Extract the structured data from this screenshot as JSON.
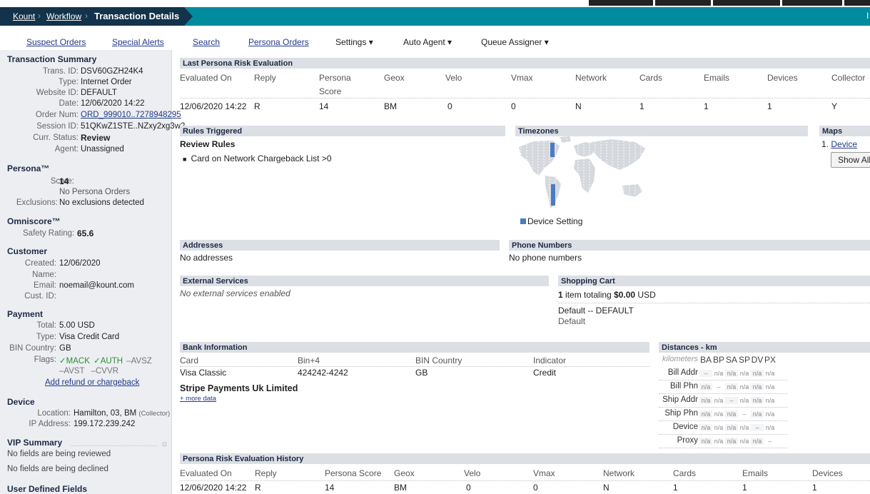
{
  "breadcrumb": {
    "items": [
      "Kount",
      "Workflow"
    ],
    "current": "Transaction Details",
    "right": "l"
  },
  "nav": {
    "suspect": "Suspect Orders",
    "alerts": "Special Alerts",
    "search": "Search",
    "persona": "Persona Orders",
    "settings": "Settings ▾",
    "auto": "Auto Agent ▾",
    "queue": "Queue Assigner ▾"
  },
  "summary": {
    "title": "Transaction Summary",
    "rows": [
      [
        "Trans. ID:",
        "DSV60GZH24K4"
      ],
      [
        "Type:",
        "Internet Order"
      ],
      [
        "Website ID:",
        "DEFAULT"
      ],
      [
        "Date:",
        "12/06/2020 14:22"
      ],
      [
        "Order Num:",
        "ORD_999010..7278948295"
      ],
      [
        "Session ID:",
        "51QKwZ1STE..NZxy2xg3w2"
      ],
      [
        "Curr. Status:",
        "Review"
      ],
      [
        "Agent:",
        "Unassigned"
      ]
    ]
  },
  "persona": {
    "title": "Persona™",
    "score_label": "Score:",
    "score": "14",
    "orders": "No Persona Orders",
    "excl_label": "Exclusions:",
    "excl": "No exclusions detected"
  },
  "omni": {
    "title": "Omniscore™",
    "label": "Safety Rating:",
    "value": "65.6"
  },
  "customer": {
    "title": "Customer",
    "rows": [
      [
        "Created:",
        "12/06/2020"
      ],
      [
        "Name:",
        ""
      ],
      [
        "Email:",
        "noemail@kount.com"
      ],
      [
        "Cust. ID:",
        ""
      ]
    ]
  },
  "payment": {
    "title": "Payment",
    "rows": [
      [
        "Total:",
        "5.00 USD"
      ],
      [
        "Type:",
        "Visa Credit Card"
      ],
      [
        "BIN Country:",
        "GB"
      ]
    ],
    "flags_label": "Flags:",
    "flag1": "✓MACK",
    "flag2": "✓AUTH",
    "flag3": "–AVSZ",
    "flag4": "–AVST",
    "flag5": "–CVVR",
    "refund": "Add refund or chargeback"
  },
  "device": {
    "title": "Device",
    "loc_label": "Location:",
    "loc": "Hamilton, 03, BM",
    "loc_note": "(Collector)",
    "ip_label": "IP Address:",
    "ip": "199.172.239.242"
  },
  "vip": {
    "title": "VIP Summary",
    "reviewed": "No fields are being reviewed",
    "declined": "No fields are being declined"
  },
  "udf": {
    "title": "User Defined Fields"
  },
  "lpre": {
    "title": "Last Persona Risk Evaluation",
    "headers": [
      "Evaluated On",
      "Reply",
      "Persona",
      "Geox",
      "Velo",
      "Vmax",
      "Network",
      "Cards",
      "Emails",
      "Devices",
      "Collector"
    ],
    "header_extra": "Score",
    "row": [
      "12/06/2020 14:22",
      "R",
      "14",
      "BM",
      "0",
      "0",
      "N",
      "1",
      "1",
      "1",
      "Y"
    ]
  },
  "rules": {
    "title": "Rules Triggered",
    "sub": "Review Rules",
    "item": "Card on Network Chargeback List >0"
  },
  "tz": {
    "title": "Timezones",
    "legend": "Device Setting",
    "color": "#4a7cc4"
  },
  "maps": {
    "title": "Maps",
    "item_num": "1.",
    "item": "Device",
    "button": "Show All"
  },
  "addresses": {
    "title": "Addresses",
    "text": "No addresses"
  },
  "phones": {
    "title": "Phone Numbers",
    "text": "No phone numbers"
  },
  "ext": {
    "title": "External Services",
    "text": "No external services enabled"
  },
  "cart": {
    "title": "Shopping Cart",
    "count": "1",
    "mid": " item totaling ",
    "amount": "$0.00",
    "cur": " USD",
    "line1": "Default -- DEFAULT",
    "line2": "Default"
  },
  "bank": {
    "title": "Bank Information",
    "headers": [
      "Card",
      "Bin+4",
      "BIN Country",
      "Indicator"
    ],
    "row": [
      "Visa Classic",
      "424242-4242",
      "GB",
      "Credit"
    ],
    "issuer": "Stripe Payments Uk Limited",
    "more": "+ more data"
  },
  "dist": {
    "title": "Distances - km",
    "corner": "kilometers",
    "cols": [
      "BA",
      "BP",
      "SA",
      "SP",
      "DV",
      "PX"
    ],
    "rows": [
      {
        "label": "Bill Addr",
        "vals": [
          "–",
          "n/a",
          "n/a",
          "n/a",
          "n/a",
          "n/a"
        ]
      },
      {
        "label": "Bill Phn",
        "vals": [
          "n/a",
          "–",
          "n/a",
          "n/a",
          "n/a",
          "n/a"
        ]
      },
      {
        "label": "Ship Addr",
        "vals": [
          "n/a",
          "n/a",
          "–",
          "n/a",
          "n/a",
          "n/a"
        ]
      },
      {
        "label": "Ship Phn",
        "vals": [
          "n/a",
          "n/a",
          "n/a",
          "–",
          "n/a",
          "n/a"
        ]
      },
      {
        "label": "Device",
        "vals": [
          "n/a",
          "n/a",
          "n/a",
          "n/a",
          "–",
          "n/a"
        ]
      },
      {
        "label": "Proxy",
        "vals": [
          "n/a",
          "n/a",
          "n/a",
          "n/a",
          "n/a",
          "–"
        ]
      }
    ]
  },
  "hist": {
    "title": "Persona Risk Evaluation History",
    "headers": [
      "Evaluated On",
      "Reply",
      "Persona Score",
      "Geox",
      "Velo",
      "Vmax",
      "Network",
      "Cards",
      "Emails",
      "Devices"
    ],
    "row": [
      "12/06/2020 14:22",
      "R",
      "14",
      "BM",
      "0",
      "0",
      "N",
      "1",
      "1",
      "1"
    ]
  }
}
